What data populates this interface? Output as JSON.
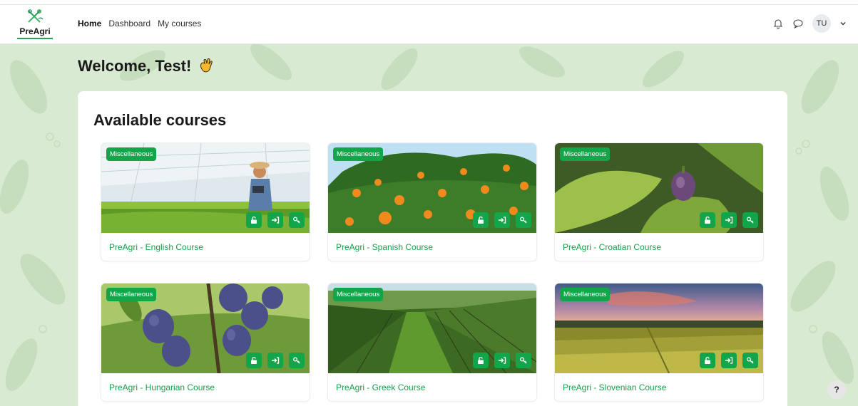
{
  "brand": {
    "name": "PreAgri"
  },
  "nav": {
    "home": "Home",
    "dashboard": "Dashboard",
    "my_courses": "My courses",
    "avatar_initials": "TU"
  },
  "welcome": {
    "text": "Welcome, Test!"
  },
  "courses": {
    "heading": "Available courses",
    "items": [
      {
        "category": "Miscellaneous",
        "title": "PreAgri - English Course"
      },
      {
        "category": "Miscellaneous",
        "title": "PreAgri - Spanish Course"
      },
      {
        "category": "Miscellaneous",
        "title": "PreAgri - Croatian Course"
      },
      {
        "category": "Miscellaneous",
        "title": "PreAgri - Hungarian Course"
      },
      {
        "category": "Miscellaneous",
        "title": "PreAgri - Greek Course"
      },
      {
        "category": "Miscellaneous",
        "title": "PreAgri - Slovenian Course"
      }
    ]
  },
  "help": {
    "label": "?"
  },
  "colors": {
    "accent": "#13a54a",
    "link": "#16a04a",
    "background_leaf": "#d9ead2"
  },
  "icons": [
    "bell-icon",
    "chat-icon",
    "chevron-down-icon",
    "unlock-icon",
    "enrol-icon",
    "key-icon",
    "wave-icon"
  ]
}
